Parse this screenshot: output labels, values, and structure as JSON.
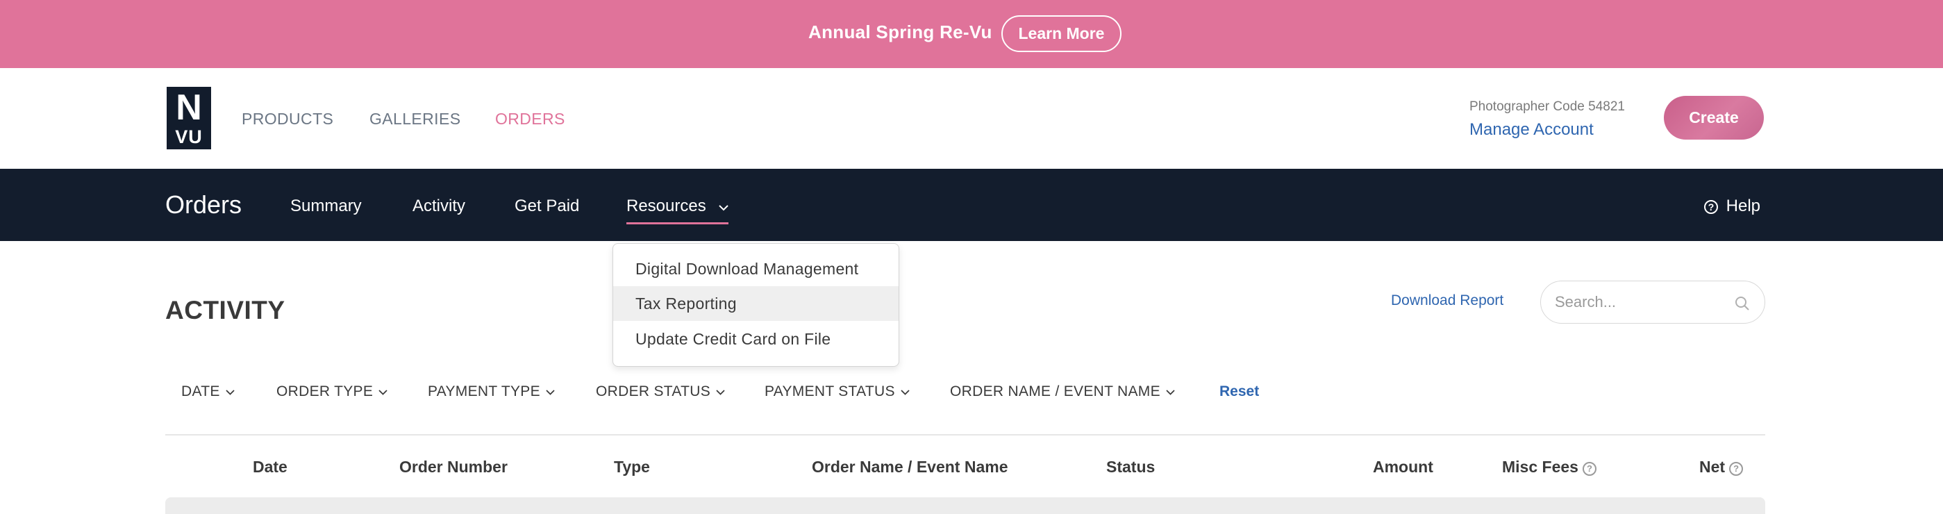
{
  "promo": {
    "text": "Annual Spring Re-Vu",
    "button_label": "Learn More"
  },
  "header": {
    "logo_big": "N",
    "logo_small": "VU",
    "nav": [
      {
        "label": "PRODUCTS"
      },
      {
        "label": "GALLERIES"
      },
      {
        "label": "ORDERS"
      }
    ],
    "photographer_code": "Photographer Code 54821",
    "manage_account": "Manage Account",
    "create_label": "Create"
  },
  "subnav": {
    "title": "Orders",
    "items": [
      {
        "label": "Summary"
      },
      {
        "label": "Activity"
      },
      {
        "label": "Get Paid"
      }
    ],
    "resources_label": "Resources",
    "help_label": "Help"
  },
  "dropdown": {
    "items": [
      {
        "label": "Digital Download Management"
      },
      {
        "label": "Tax Reporting"
      },
      {
        "label": "Update Credit Card on File"
      }
    ]
  },
  "activity": {
    "title": "ACTIVITY",
    "download_report": "Download Report",
    "search_placeholder": "Search..."
  },
  "filters": {
    "items": [
      {
        "label": "DATE"
      },
      {
        "label": "ORDER TYPE"
      },
      {
        "label": "PAYMENT TYPE"
      },
      {
        "label": "ORDER STATUS"
      },
      {
        "label": "PAYMENT STATUS"
      },
      {
        "label": "ORDER NAME / EVENT NAME"
      }
    ],
    "reset_label": "Reset"
  },
  "table": {
    "columns": [
      {
        "label": "Date"
      },
      {
        "label": "Order Number"
      },
      {
        "label": "Type"
      },
      {
        "label": "Order Name / Event Name"
      },
      {
        "label": "Status"
      },
      {
        "label": "Amount"
      },
      {
        "label": "Misc Fees"
      },
      {
        "label": "Net"
      }
    ]
  },
  "colors": {
    "accent_pink": "#e0739a",
    "nav_dark": "#131d2d",
    "link_blue": "#2f66b0"
  }
}
